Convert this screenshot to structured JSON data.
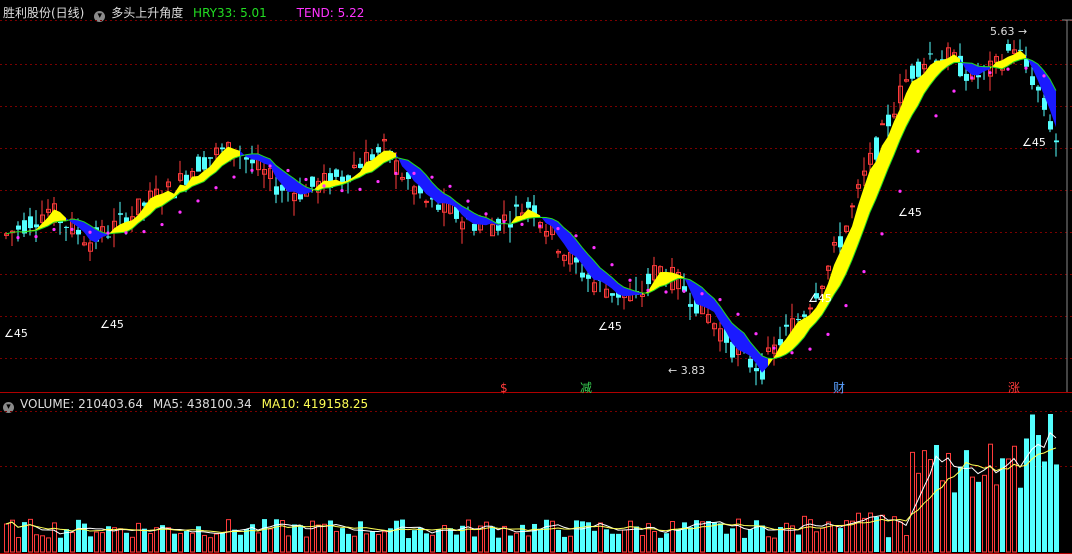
{
  "header": {
    "stock_label": "胜利股份(日线)",
    "indicator_name": "多头上升角度",
    "hry_label": "HRY33: 5.01",
    "tend_label": "TEND: 5.22"
  },
  "volume_header": {
    "volume_label": "VOLUME: 210403.64",
    "ma5_label": "MA5: 438100.34",
    "ma10_label": "MA10: 419158.25"
  },
  "annotations": {
    "high_price": "5.63",
    "low_price": "3.83",
    "angle_marks": [
      "∠45",
      "∠45",
      "∠45",
      "∠45",
      "∠45",
      "∠45"
    ]
  },
  "event_markers": [
    {
      "text": "$",
      "color": "#ff3b3b"
    },
    {
      "text": "减",
      "color": "#39d353"
    },
    {
      "text": "财",
      "color": "#5aa0ff"
    },
    {
      "text": "涨",
      "color": "#ff3b3b"
    }
  ],
  "colors": {
    "up": "#ff3b3b",
    "down": "#54ffff",
    "ribbon_bull": "#ffff00",
    "ribbon_bear": "#1a1aff",
    "tend_dots": "#ff33ff",
    "hry_text": "#22dd22",
    "tend_text": "#ff33ff",
    "ma5": "#ffffff",
    "ma10": "#ffff55",
    "grid": "#7a0000"
  },
  "chart_data": {
    "type": "candlestick",
    "close_path": [
      4.55,
      4.62,
      4.68,
      4.6,
      4.52,
      4.58,
      4.66,
      4.75,
      4.8,
      4.92,
      4.98,
      5.0,
      4.9,
      4.8,
      4.78,
      4.82,
      4.86,
      4.95,
      5.0,
      4.85,
      4.72,
      4.68,
      4.62,
      4.6,
      4.65,
      4.72,
      4.55,
      4.4,
      4.3,
      4.25,
      4.2,
      4.38,
      4.3,
      4.18,
      4.05,
      3.9,
      3.85,
      4.02,
      4.15,
      4.35,
      4.6,
      4.9,
      5.15,
      5.4,
      5.5,
      5.48,
      5.38,
      5.42,
      5.55,
      5.35,
      5.05
    ],
    "price_range": [
      3.83,
      5.63
    ],
    "volume_ma5_last": 438100.34,
    "volume_ma10_last": 419158.25,
    "volume_last": 210403.64
  }
}
